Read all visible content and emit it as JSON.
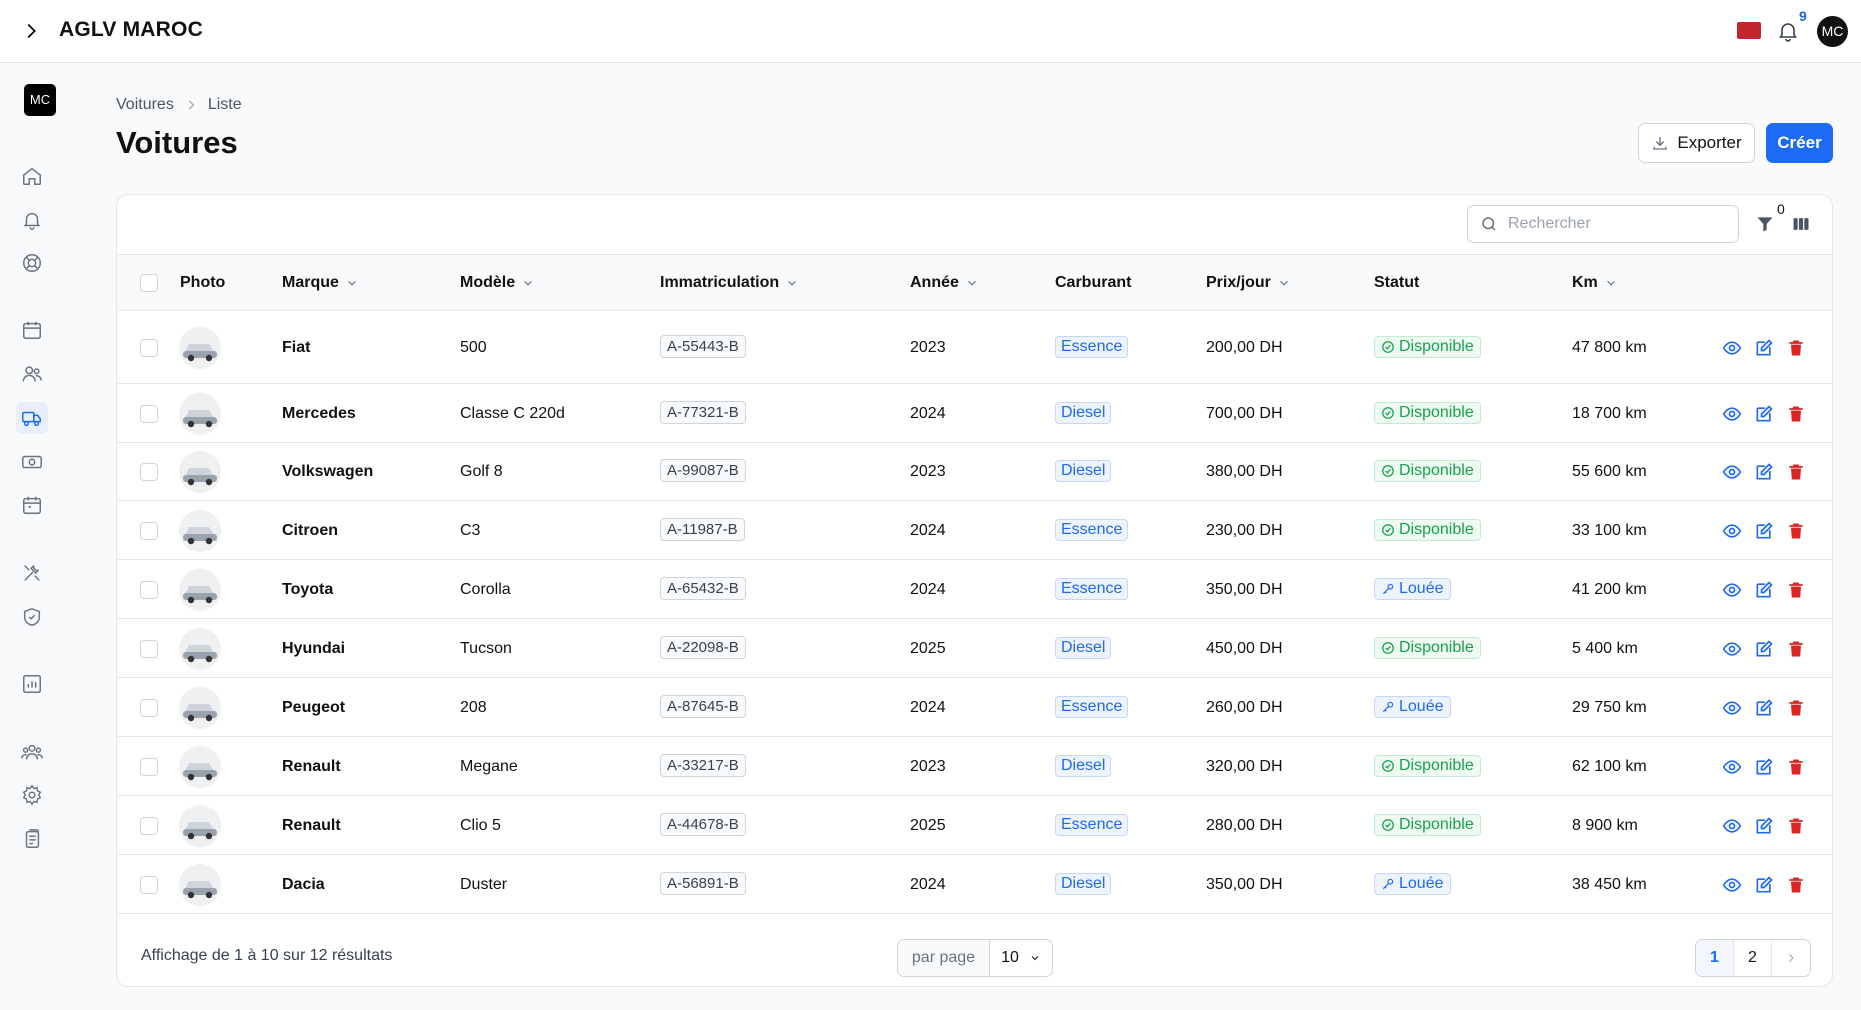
{
  "app": {
    "title": "AGLV MAROC",
    "user_initials": "MC",
    "notifications_count": "9"
  },
  "breadcrumb": {
    "parent": "Voitures",
    "current": "Liste"
  },
  "page": {
    "title": "Voitures",
    "export_label": "Exporter",
    "create_label": "Créer"
  },
  "toolbar": {
    "search_placeholder": "Rechercher",
    "filter_count": "0"
  },
  "table": {
    "columns": {
      "photo": "Photo",
      "marque": "Marque",
      "modele": "Modèle",
      "immat": "Immatriculation",
      "annee": "Année",
      "carburant": "Carburant",
      "prix": "Prix/jour",
      "statut": "Statut",
      "km": "Km"
    },
    "rows": [
      {
        "marque": "Fiat",
        "modele": "500",
        "immat": "A-55443-B",
        "annee": "2023",
        "carburant": "Essence",
        "prix": "200,00 DH",
        "statut": "Disponible",
        "km": "47 800 km"
      },
      {
        "marque": "Mercedes",
        "modele": "Classe C 220d",
        "immat": "A-77321-B",
        "annee": "2024",
        "carburant": "Diesel",
        "prix": "700,00 DH",
        "statut": "Disponible",
        "km": "18 700 km"
      },
      {
        "marque": "Volkswagen",
        "modele": "Golf 8",
        "immat": "A-99087-B",
        "annee": "2023",
        "carburant": "Diesel",
        "prix": "380,00 DH",
        "statut": "Disponible",
        "km": "55 600 km"
      },
      {
        "marque": "Citroen",
        "modele": "C3",
        "immat": "A-11987-B",
        "annee": "2024",
        "carburant": "Essence",
        "prix": "230,00 DH",
        "statut": "Disponible",
        "km": "33 100 km"
      },
      {
        "marque": "Toyota",
        "modele": "Corolla",
        "immat": "A-65432-B",
        "annee": "2024",
        "carburant": "Essence",
        "prix": "350,00 DH",
        "statut": "Louée",
        "km": "41 200 km"
      },
      {
        "marque": "Hyundai",
        "modele": "Tucson",
        "immat": "A-22098-B",
        "annee": "2025",
        "carburant": "Diesel",
        "prix": "450,00 DH",
        "statut": "Disponible",
        "km": "5 400 km"
      },
      {
        "marque": "Peugeot",
        "modele": "208",
        "immat": "A-87645-B",
        "annee": "2024",
        "carburant": "Essence",
        "prix": "260,00 DH",
        "statut": "Louée",
        "km": "29 750 km"
      },
      {
        "marque": "Renault",
        "modele": "Megane",
        "immat": "A-33217-B",
        "annee": "2023",
        "carburant": "Diesel",
        "prix": "320,00 DH",
        "statut": "Disponible",
        "km": "62 100 km"
      },
      {
        "marque": "Renault",
        "modele": "Clio 5",
        "immat": "A-44678-B",
        "annee": "2025",
        "carburant": "Essence",
        "prix": "280,00 DH",
        "statut": "Disponible",
        "km": "8 900 km"
      },
      {
        "marque": "Dacia",
        "modele": "Duster",
        "immat": "A-56891-B",
        "annee": "2024",
        "carburant": "Diesel",
        "prix": "350,00 DH",
        "statut": "Louée",
        "km": "38 450 km"
      }
    ]
  },
  "footer": {
    "results_text": "Affichage de 1 à 10 sur 12 résultats",
    "per_page_label": "par page",
    "per_page_value": "10",
    "pages": [
      "1",
      "2"
    ]
  },
  "colors": {
    "accent": "#1d6af4",
    "available": "#16a34a",
    "danger": "#dc2626",
    "flag": "#c1272d"
  }
}
